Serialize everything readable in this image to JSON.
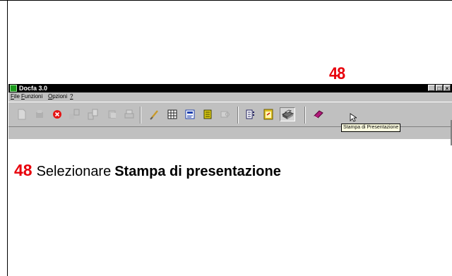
{
  "step_number": "48",
  "window": {
    "title": "Docfa 3.0",
    "controls": {
      "minimize": "_",
      "maximize": "□",
      "close": "×"
    }
  },
  "menu": [
    {
      "accel": "F",
      "rest": "ile"
    },
    {
      "accel": "F",
      "rest": "unzioni"
    },
    {
      "accel": "O",
      "rest": "pzioni"
    },
    {
      "accel": "?",
      "rest": ""
    }
  ],
  "toolbar": {
    "buttons": [
      {
        "icon": "new-document-icon",
        "color": "#bdbdbd"
      },
      {
        "icon": "open-folder-icon",
        "color": "#a8a8a8"
      },
      {
        "icon": "delete-icon",
        "color": "#e51414"
      },
      {
        "icon": "copy-icon",
        "color": "#a8a8a8"
      },
      {
        "icon": "duplicate-icon",
        "color": "#a8a8a8"
      },
      {
        "icon": "paste-icon",
        "color": "#a8a8a8"
      },
      {
        "icon": "print-disabled-icon",
        "color": "#a8a8a8"
      },
      {
        "icon": "brush-icon",
        "color": "#c89a2a"
      },
      {
        "icon": "grid-icon",
        "color": "#202020"
      },
      {
        "icon": "form-icon",
        "color": "#1e3fae"
      },
      {
        "icon": "list-icon",
        "color": "#d9c812"
      },
      {
        "icon": "tape-icon",
        "color": "#a8a8a8"
      },
      {
        "icon": "columns-icon",
        "color": "#202060"
      },
      {
        "icon": "notes-icon",
        "color": "#e0c020"
      },
      {
        "icon": "printer-icon",
        "color": "#606060"
      },
      {
        "icon": "book-icon",
        "color": "#b01a7a"
      }
    ],
    "tooltip": "Stampa di Presentazione"
  },
  "caption": {
    "number": "48",
    "text": "Selezionare",
    "bold": "Stampa di presentazione"
  }
}
